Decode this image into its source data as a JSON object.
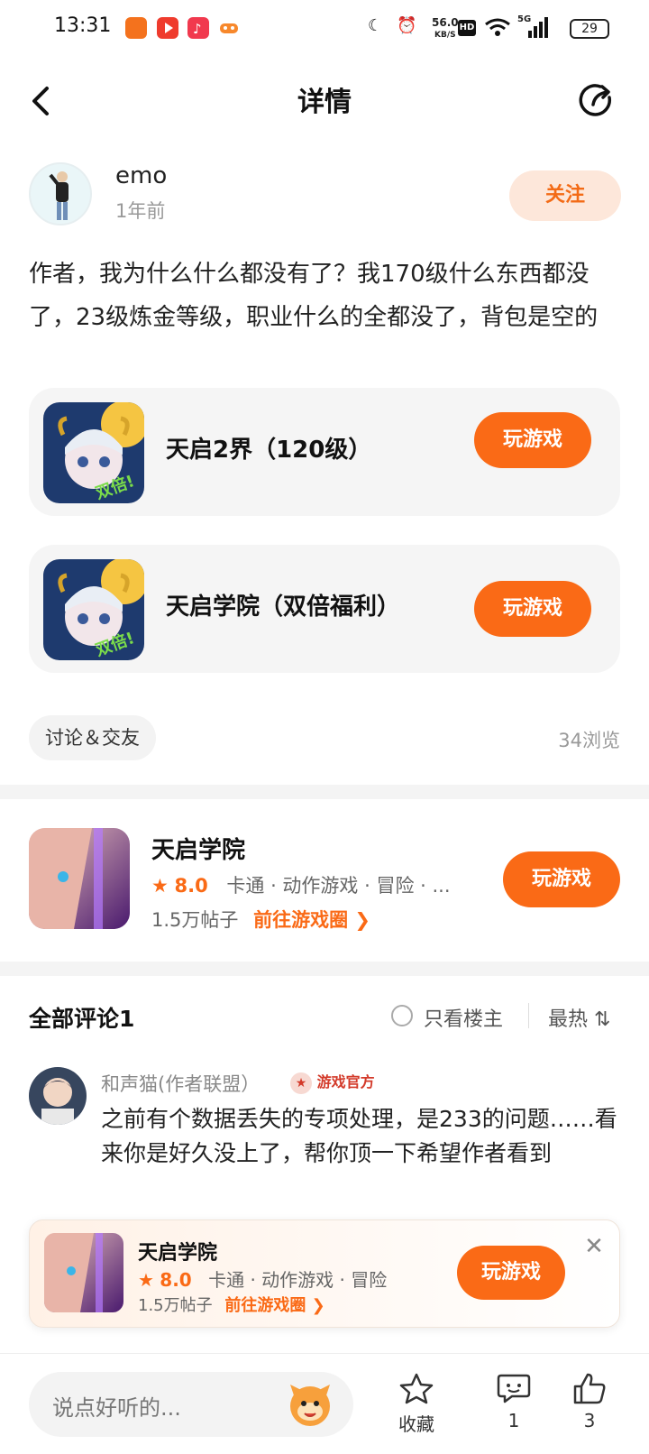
{
  "status_bar": {
    "time": "13:31",
    "net_speed": "56.0",
    "net_unit": "KB/S",
    "hd": "HD",
    "signal": "5G",
    "battery": "29"
  },
  "header": {
    "title": "详情"
  },
  "post": {
    "author": "emo",
    "time": "1年前",
    "follow_label": "关注",
    "body": "作者，我为什么什么都没有了？我170级什么东西都没了，23级炼金等级，职业什么的全都没了，背包是空的",
    "tag": "讨论＆交友",
    "views": "34浏览"
  },
  "game_cards": [
    {
      "name": "天启2界（120级）",
      "play_label": "玩游戏",
      "thumb_text": "双倍!"
    },
    {
      "name": "天启学院（双倍福利）",
      "play_label": "玩游戏",
      "thumb_text": "双倍!"
    }
  ],
  "game_circle": {
    "title": "天启学院",
    "star": "★",
    "rating": "8.0",
    "tags": "卡通 · 动作游戏 · 冒险 · ...",
    "posts": "1.5万帖子",
    "goto_label": "前往游戏圈 ❯",
    "play_label": "玩游戏"
  },
  "comments": {
    "title": "全部评论1",
    "only_op": "只看楼主",
    "sort": "最热 ⇅",
    "items": [
      {
        "name": "和声猫(作者联盟）",
        "badge": "游戏官方",
        "text": "之前有个数据丢失的专项处理，是233的问题……看来你是好久没上了，帮你顶一下希望作者看到"
      }
    ]
  },
  "floating_card": {
    "title": "天启学院",
    "star": "★",
    "rating": "8.0",
    "tags": "卡通 · 动作游戏 · 冒险",
    "posts": "1.5万帖子",
    "goto_label": "前往游戏圈 ❯",
    "play_label": "玩游戏",
    "close": "✕"
  },
  "bottom_bar": {
    "input_placeholder": "说点好听的...",
    "favorite_label": "收藏",
    "comment_count": "1",
    "like_count": "3"
  },
  "colors": {
    "accent": "#fa6a16",
    "follow_bg": "#fde7da",
    "card_bg": "#f5f5f5"
  }
}
